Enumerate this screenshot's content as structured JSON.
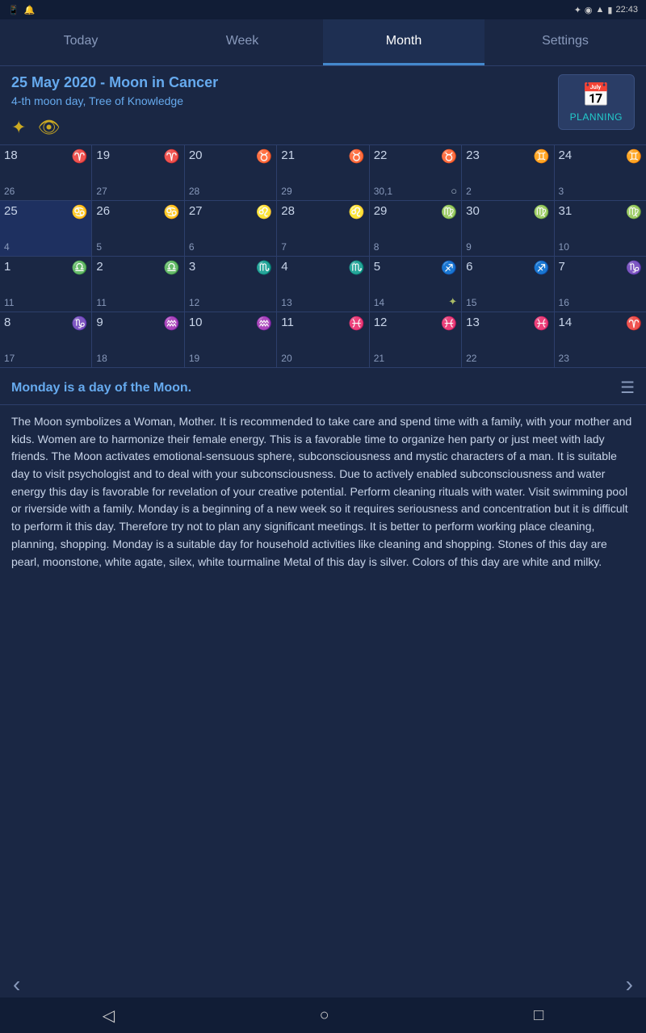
{
  "statusBar": {
    "time": "22:43",
    "icons": [
      "bluetooth",
      "notification",
      "wifi",
      "battery"
    ]
  },
  "tabs": [
    {
      "label": "Today",
      "active": false
    },
    {
      "label": "Week",
      "active": false
    },
    {
      "label": "Month",
      "active": true
    },
    {
      "label": "Settings",
      "active": false
    }
  ],
  "header": {
    "title": "25 May 2020 - Moon in Cancer",
    "subtitle": "4-th moon day, Tree of Knowledge",
    "planning_label": "PLANNING"
  },
  "calendar": {
    "rows": [
      {
        "cells": [
          {
            "day": "18",
            "zodiac": "♈",
            "moon_day": "26",
            "phase": ""
          },
          {
            "day": "19",
            "zodiac": "♈",
            "moon_day": "27",
            "phase": ""
          },
          {
            "day": "20",
            "zodiac": "♉",
            "moon_day": "28",
            "phase": ""
          },
          {
            "day": "21",
            "zodiac": "♉",
            "moon_day": "29",
            "phase": ""
          },
          {
            "day": "22",
            "zodiac": "♉",
            "moon_day": "30,1",
            "phase": "○"
          },
          {
            "day": "23",
            "zodiac": "♊",
            "moon_day": "2",
            "phase": ""
          },
          {
            "day": "24",
            "zodiac": "♊",
            "moon_day": "3",
            "phase": ""
          }
        ]
      },
      {
        "cells": [
          {
            "day": "25",
            "zodiac": "♋",
            "moon_day": "4",
            "phase": "",
            "today": true
          },
          {
            "day": "26",
            "zodiac": "♋",
            "moon_day": "5",
            "phase": ""
          },
          {
            "day": "27",
            "zodiac": "♌",
            "moon_day": "6",
            "phase": ""
          },
          {
            "day": "28",
            "zodiac": "♌",
            "moon_day": "7",
            "phase": ""
          },
          {
            "day": "29",
            "zodiac": "♍",
            "moon_day": "8",
            "phase": ""
          },
          {
            "day": "30",
            "zodiac": "♍",
            "moon_day": "9",
            "phase": ""
          },
          {
            "day": "31",
            "zodiac": "♍",
            "moon_day": "10",
            "phase": ""
          }
        ]
      },
      {
        "cells": [
          {
            "day": "1",
            "zodiac": "♎",
            "moon_day": "11",
            "phase": ""
          },
          {
            "day": "2",
            "zodiac": "♎",
            "moon_day": "11",
            "phase": ""
          },
          {
            "day": "3",
            "zodiac": "♏",
            "moon_day": "12",
            "phase": ""
          },
          {
            "day": "4",
            "zodiac": "♏",
            "moon_day": "13",
            "phase": ""
          },
          {
            "day": "5",
            "zodiac": "♐",
            "moon_day": "14",
            "phase": "✦"
          },
          {
            "day": "6",
            "zodiac": "♐",
            "moon_day": "15",
            "phase": ""
          },
          {
            "day": "7",
            "zodiac": "♑",
            "moon_day": "16",
            "phase": ""
          }
        ]
      },
      {
        "cells": [
          {
            "day": "8",
            "zodiac": "♑",
            "moon_day": "17",
            "phase": ""
          },
          {
            "day": "9",
            "zodiac": "♒",
            "moon_day": "18",
            "phase": ""
          },
          {
            "day": "10",
            "zodiac": "♒",
            "moon_day": "19",
            "phase": ""
          },
          {
            "day": "11",
            "zodiac": "♓",
            "moon_day": "20",
            "phase": ""
          },
          {
            "day": "12",
            "zodiac": "♓",
            "moon_day": "21",
            "phase": ""
          },
          {
            "day": "13",
            "zodiac": "♓",
            "moon_day": "22",
            "phase": ""
          },
          {
            "day": "14",
            "zodiac": "♈",
            "moon_day": "23",
            "phase": ""
          }
        ]
      }
    ]
  },
  "dayInfo": {
    "title": "Monday is a day of the Moon.",
    "description": "The Moon symbolizes a Woman, Mother. It is recommended to take care and spend time with a family, with your mother and kids. Women are to harmonize their female energy. This is a favorable time to organize hen party or just meet with lady friends. The Moon activates emotional-sensuous sphere, subconsciousness and mystic characters of a man. It is suitable day to visit psychologist and to deal with your subconsciousness. Due to actively enabled subconsciousness and water energy this day is favorable for revelation of your creative potential. Perform cleaning rituals with water. Visit swimming pool or riverside with a family. Monday is a beginning of a new week so it requires seriousness and concentration but it is difficult to perform it this day. Therefore try not to plan any significant meetings. It is better to perform working place cleaning, planning, shopping. Monday is a suitable day for household activities like cleaning and shopping. Stones of this day are pearl, moonstone, white agate, silex, white tourmaline Metal of this day is silver. Colors of this day are white and milky."
  },
  "nav": {
    "prev": "‹",
    "next": "›"
  }
}
